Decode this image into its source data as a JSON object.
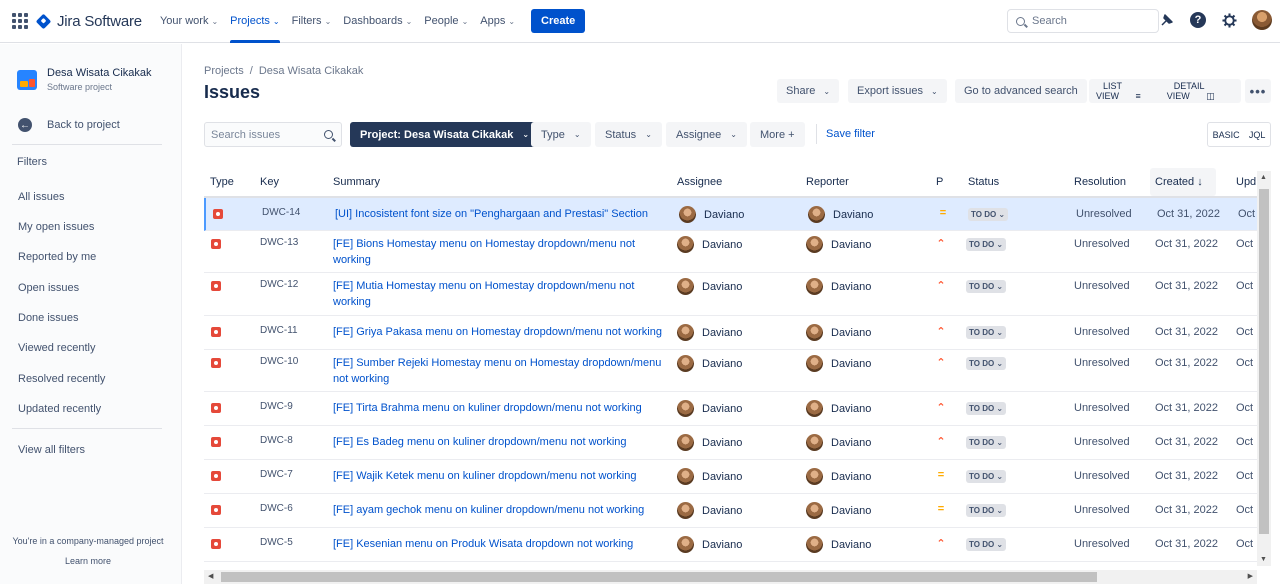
{
  "topnav": {
    "app_name": "Jira Software",
    "items": [
      {
        "label": "Your work"
      },
      {
        "label": "Projects"
      },
      {
        "label": "Filters"
      },
      {
        "label": "Dashboards"
      },
      {
        "label": "People"
      },
      {
        "label": "Apps"
      }
    ],
    "create_label": "Create",
    "search_placeholder": "Search"
  },
  "sidebar": {
    "project_name": "Desa Wisata Cikakak",
    "project_type": "Software project",
    "back_label": "Back to project",
    "filters_heading": "Filters",
    "items": [
      {
        "label": "All issues"
      },
      {
        "label": "My open issues"
      },
      {
        "label": "Reported by me"
      },
      {
        "label": "Open issues"
      },
      {
        "label": "Done issues"
      },
      {
        "label": "Viewed recently"
      },
      {
        "label": "Resolved recently"
      },
      {
        "label": "Updated recently"
      }
    ],
    "view_all_filters": "View all filters",
    "footer_text": "You're in a company-managed project",
    "learn_more": "Learn more"
  },
  "main": {
    "breadcrumb": {
      "projects": "Projects",
      "separator": "/",
      "project": "Desa Wisata Cikakak"
    },
    "title": "Issues",
    "share_label": "Share",
    "export_label": "Export issues",
    "advanced_search_label": "Go to advanced search",
    "list_view_label": "LIST VIEW",
    "detail_view_label": "DETAIL VIEW",
    "more_label": "•••",
    "filter_bar": {
      "search_placeholder": "Search issues",
      "project_filter": "Project: Desa Wisata Cikakak",
      "type_label": "Type",
      "status_label": "Status",
      "assignee_label": "Assignee",
      "more_label": "More +",
      "save_filter": "Save filter",
      "basic_label": "BASIC",
      "jql_label": "JQL"
    }
  },
  "table": {
    "columns": {
      "type": "Type",
      "key": "Key",
      "summary": "Summary",
      "assignee": "Assignee",
      "reporter": "Reporter",
      "priority": "P",
      "status": "Status",
      "resolution": "Resolution",
      "created": "Created",
      "updated": "Upd"
    },
    "sort_indicator": "↓",
    "rows": [
      {
        "key": "DWC-14",
        "summary": "[UI] Incosistent font size on \"Penghargaan and Prestasi\" Section",
        "assignee": "Daviano",
        "reporter": "Daviano",
        "priority": "medium",
        "status": "TO DO",
        "resolution": "Unresolved",
        "created": "Oct 31, 2022",
        "updated": "Oct"
      },
      {
        "key": "DWC-13",
        "summary": "[FE] Bions Homestay menu on Homestay dropdown/menu not working",
        "assignee": "Daviano",
        "reporter": "Daviano",
        "priority": "high",
        "status": "TO DO",
        "resolution": "Unresolved",
        "created": "Oct 31, 2022",
        "updated": "Oct"
      },
      {
        "key": "DWC-12",
        "summary": "[FE] Mutia Homestay menu on Homestay dropdown/menu not working",
        "assignee": "Daviano",
        "reporter": "Daviano",
        "priority": "high",
        "status": "TO DO",
        "resolution": "Unresolved",
        "created": "Oct 31, 2022",
        "updated": "Oct"
      },
      {
        "key": "DWC-11",
        "summary": "[FE] Griya Pakasa menu on Homestay dropdown/menu not working",
        "assignee": "Daviano",
        "reporter": "Daviano",
        "priority": "high",
        "status": "TO DO",
        "resolution": "Unresolved",
        "created": "Oct 31, 2022",
        "updated": "Oct"
      },
      {
        "key": "DWC-10",
        "summary": "[FE] Sumber Rejeki Homestay menu on Homestay dropdown/menu not working",
        "assignee": "Daviano",
        "reporter": "Daviano",
        "priority": "high",
        "status": "TO DO",
        "resolution": "Unresolved",
        "created": "Oct 31, 2022",
        "updated": "Oct"
      },
      {
        "key": "DWC-9",
        "summary": "[FE] Tirta Brahma menu on kuliner dropdown/menu not working",
        "assignee": "Daviano",
        "reporter": "Daviano",
        "priority": "high",
        "status": "TO DO",
        "resolution": "Unresolved",
        "created": "Oct 31, 2022",
        "updated": "Oct"
      },
      {
        "key": "DWC-8",
        "summary": "[FE] Es Badeg menu on kuliner dropdown/menu not working",
        "assignee": "Daviano",
        "reporter": "Daviano",
        "priority": "high",
        "status": "TO DO",
        "resolution": "Unresolved",
        "created": "Oct 31, 2022",
        "updated": "Oct"
      },
      {
        "key": "DWC-7",
        "summary": "[FE] Wajik Ketek menu on kuliner dropdown/menu not working",
        "assignee": "Daviano",
        "reporter": "Daviano",
        "priority": "medium",
        "status": "TO DO",
        "resolution": "Unresolved",
        "created": "Oct 31, 2022",
        "updated": "Oct"
      },
      {
        "key": "DWC-6",
        "summary": "[FE] ayam gechok menu on kuliner dropdown/menu not working",
        "assignee": "Daviano",
        "reporter": "Daviano",
        "priority": "medium",
        "status": "TO DO",
        "resolution": "Unresolved",
        "created": "Oct 31, 2022",
        "updated": "Oct"
      },
      {
        "key": "DWC-5",
        "summary": "[FE] Kesenian menu on Produk Wisata dropdown not working",
        "assignee": "Daviano",
        "reporter": "Daviano",
        "priority": "high",
        "status": "TO DO",
        "resolution": "Unresolved",
        "created": "Oct 31, 2022",
        "updated": "Oct"
      }
    ]
  },
  "colors": {
    "brand": "#0052cc",
    "bug": "#e5493a",
    "priority_high": "#ff5630",
    "priority_medium": "#ffab00",
    "selected_row": "#deebff"
  }
}
